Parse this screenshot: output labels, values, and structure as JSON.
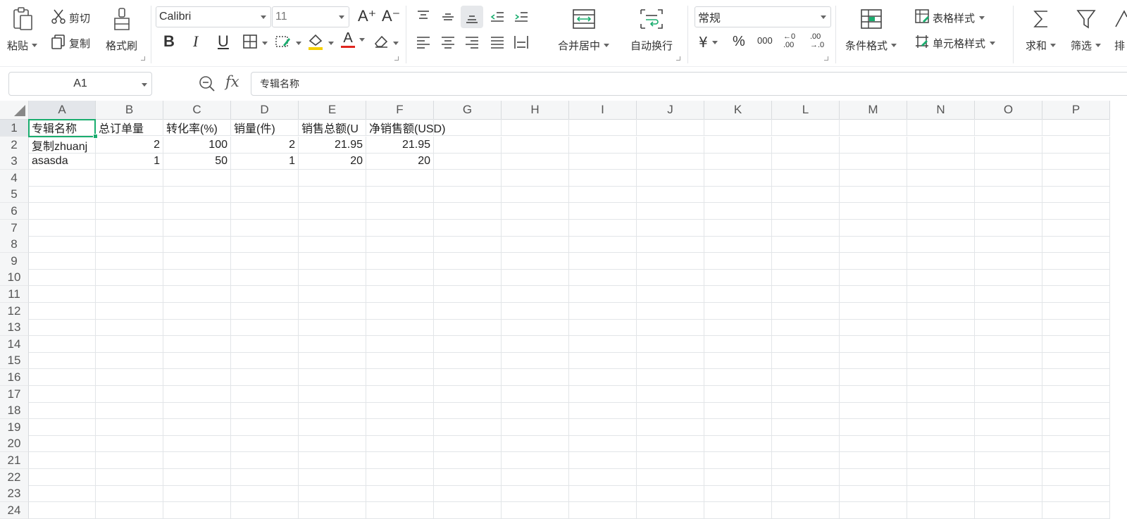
{
  "ribbon": {
    "clipboard": {
      "paste": "粘贴",
      "cut": "剪切",
      "copy": "复制",
      "format_painter": "格式刷"
    },
    "font": {
      "name": "Calibri",
      "size": "11",
      "increase_size": "A⁺",
      "decrease_size": "A⁻",
      "bold": "B",
      "italic": "I",
      "underline": "U",
      "font_color": "A",
      "font_color_hex": "#e0261f",
      "fill_color_hex": "#f5d000"
    },
    "alignment": {
      "merge_center": "合并居中",
      "wrap_text": "自动换行"
    },
    "number": {
      "format": "常规",
      "currency": "¥",
      "percent": "%",
      "thousands": "000",
      "inc_decimal": "←0\n.00",
      "dec_decimal": ".00\n→.0"
    },
    "styles": {
      "conditional_format": "条件格式",
      "table_style": "表格样式",
      "cell_style": "单元格样式"
    },
    "editing": {
      "sum": "求和",
      "filter": "筛选",
      "sort": "排"
    }
  },
  "formula_bar": {
    "name_box": "A1",
    "fx": "fx",
    "content": "专辑名称"
  },
  "grid": {
    "columns": [
      "A",
      "B",
      "C",
      "D",
      "E",
      "F",
      "G",
      "H",
      "I",
      "J",
      "K",
      "L",
      "M",
      "N",
      "O",
      "P"
    ],
    "rows": [
      "1",
      "2",
      "3",
      "4",
      "5",
      "6",
      "7",
      "8",
      "9",
      "10",
      "11",
      "12",
      "13",
      "14",
      "15",
      "16",
      "17",
      "18",
      "19",
      "20",
      "21",
      "22",
      "23",
      "24"
    ],
    "cells": {
      "A1": "专辑名称",
      "B1": "总订单量",
      "C1": "转化率(%)",
      "D1": "销量(件)",
      "E1": "销售总额(U",
      "F1": "净销售额(USD)",
      "A2": "复制zhuanj",
      "B2": "2",
      "C2": "100",
      "D2": "2",
      "E2": "21.95",
      "F2": "21.95",
      "A3": "asasda",
      "B3": "1",
      "C3": "50",
      "D3": "1",
      "E3": "20",
      "F3": "20"
    },
    "selected_cell": "A1",
    "accent_hex": "#1aad6f"
  }
}
